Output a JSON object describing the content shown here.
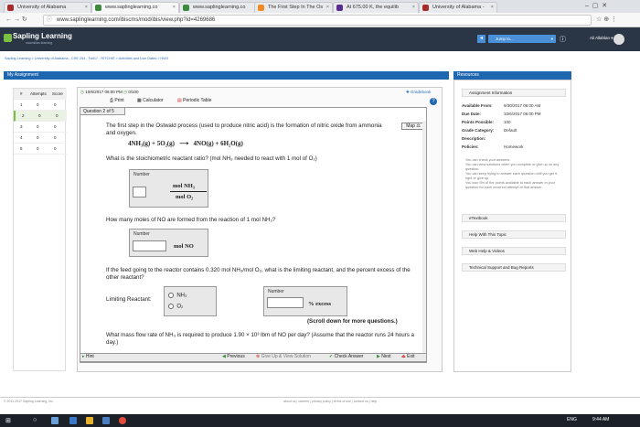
{
  "browser": {
    "tabs": [
      {
        "label": "University of Alabama",
        "active": false
      },
      {
        "label": "www.saplinglearning.co",
        "active": true
      },
      {
        "label": "www.saplinglearning.co",
        "active": false
      },
      {
        "label": "The First Step In The Os",
        "active": false
      },
      {
        "label": "At 675.00 K, the equilib",
        "active": false
      },
      {
        "label": "University of Alabama -",
        "active": false
      }
    ],
    "url": "www.saplinglearning.com/ibiscms/mod/ibis/view.php?id=4269686"
  },
  "header": {
    "logo": "Sapling Learning",
    "logo_sub": "macmillan learning",
    "jump_to": "Jump to...",
    "user": "Ali Allahlan"
  },
  "breadcrumb": "Sapling Learning  >  University of Alabama - CHE 254 - Fall17 - RITCHIE  >  Activities and Due Dates  >  HW3",
  "assignment_bar": "My Assignment",
  "resources_bar": "Resources",
  "score_table": {
    "headers": [
      "#",
      "Attempts",
      "Score"
    ],
    "rows": [
      [
        "1",
        "0",
        "0"
      ],
      [
        "2",
        "0",
        "0"
      ],
      [
        "3",
        "0",
        "0"
      ],
      [
        "4",
        "0",
        "0"
      ],
      [
        "5",
        "0",
        "0"
      ]
    ]
  },
  "question_toolbar": {
    "date": "10/6/2017 06:00 PM",
    "score": "0/100",
    "print": "Print",
    "calculator": "Calculator",
    "periodic_table": "Periodic Table",
    "gradebook": "Gradebook"
  },
  "question": {
    "number": "Question 2 of 5",
    "map": "Map",
    "intro": "The first step in the Ostwald process (used to produce nitric acid) is the formation of nitric oxide from ammonia and oxygen.",
    "equation_left": "4NH₃(g) + 5O₂(g)",
    "equation_arrow": "⟶",
    "equation_right": "4NO(g) + 6H₂O(g)",
    "q1": "What is the stoichiometric reactant ratio? (mol NH₃ needed to react with 1 mol of O₂)",
    "number_label": "Number",
    "q1_num_unit": "mol  NH₃",
    "q1_den_unit": "mol  O₂",
    "q2": "How many moles of NO are formed from the reaction of 1 mol NH₃?",
    "q2_unit": "mol  NO",
    "q3": "If the feed going to the reactor contains 0.320 mol NH₃/mol O₂, what is the limiting reactant, and the percent excess of the other reactant?",
    "limiting_label": "Limiting Reactant:",
    "option1": "NH₃",
    "option2": "O₂",
    "excess_unit": "%  excess",
    "scroll_note": "(Scroll down for more questions.)",
    "q4": "What mass flow rate of NH₃ is required to produce 1.90 × 10³ lbm of NO per day? (Assume that the reactor runs 24 hours a day.)"
  },
  "bottom_nav": {
    "hint": "Hint",
    "previous": "Previous",
    "give_up": "Give Up & View Solution",
    "check": "Check Answer",
    "next": "Next",
    "exit": "Exit"
  },
  "resources": {
    "info_head": "Assignment Information",
    "fields": [
      {
        "k": "Available From:",
        "v": "9/30/2017 06:00 AM"
      },
      {
        "k": "Due Date:",
        "v": "10/6/2017 06:00 PM"
      },
      {
        "k": "Points Possible:",
        "v": "100"
      },
      {
        "k": "Grade Category:",
        "v": "Default"
      },
      {
        "k": "Description:",
        "v": ""
      },
      {
        "k": "Policies:",
        "v": "Homework"
      }
    ],
    "policy1": "You can check your answers.",
    "policy2": "You can view solutions when you complete or give up on any question.",
    "policy3": "You can keep trying to answer each question until you get it right or give up.",
    "policy4": "You lose 5% of the points available to each answer in your question for each incorrect attempt at that answer.",
    "etextbook": "eTextbook",
    "help": "Help With This Topic",
    "weblinks": "Web Help & Videos",
    "support": "Technical Support and Bug Reports"
  },
  "footer": {
    "copyright": "© 2011-2017 Sapling Learning, Inc.",
    "links": "about us  |  careers  |  privacy policy  |  terms of use  |  contact us  |  help"
  },
  "taskbar": {
    "lang": "ENG",
    "time": "9:44 AM"
  },
  "colors": {
    "header_bg": "#2a3646",
    "accent_blue": "#1f66b0",
    "link_blue": "#2a6ebb"
  }
}
